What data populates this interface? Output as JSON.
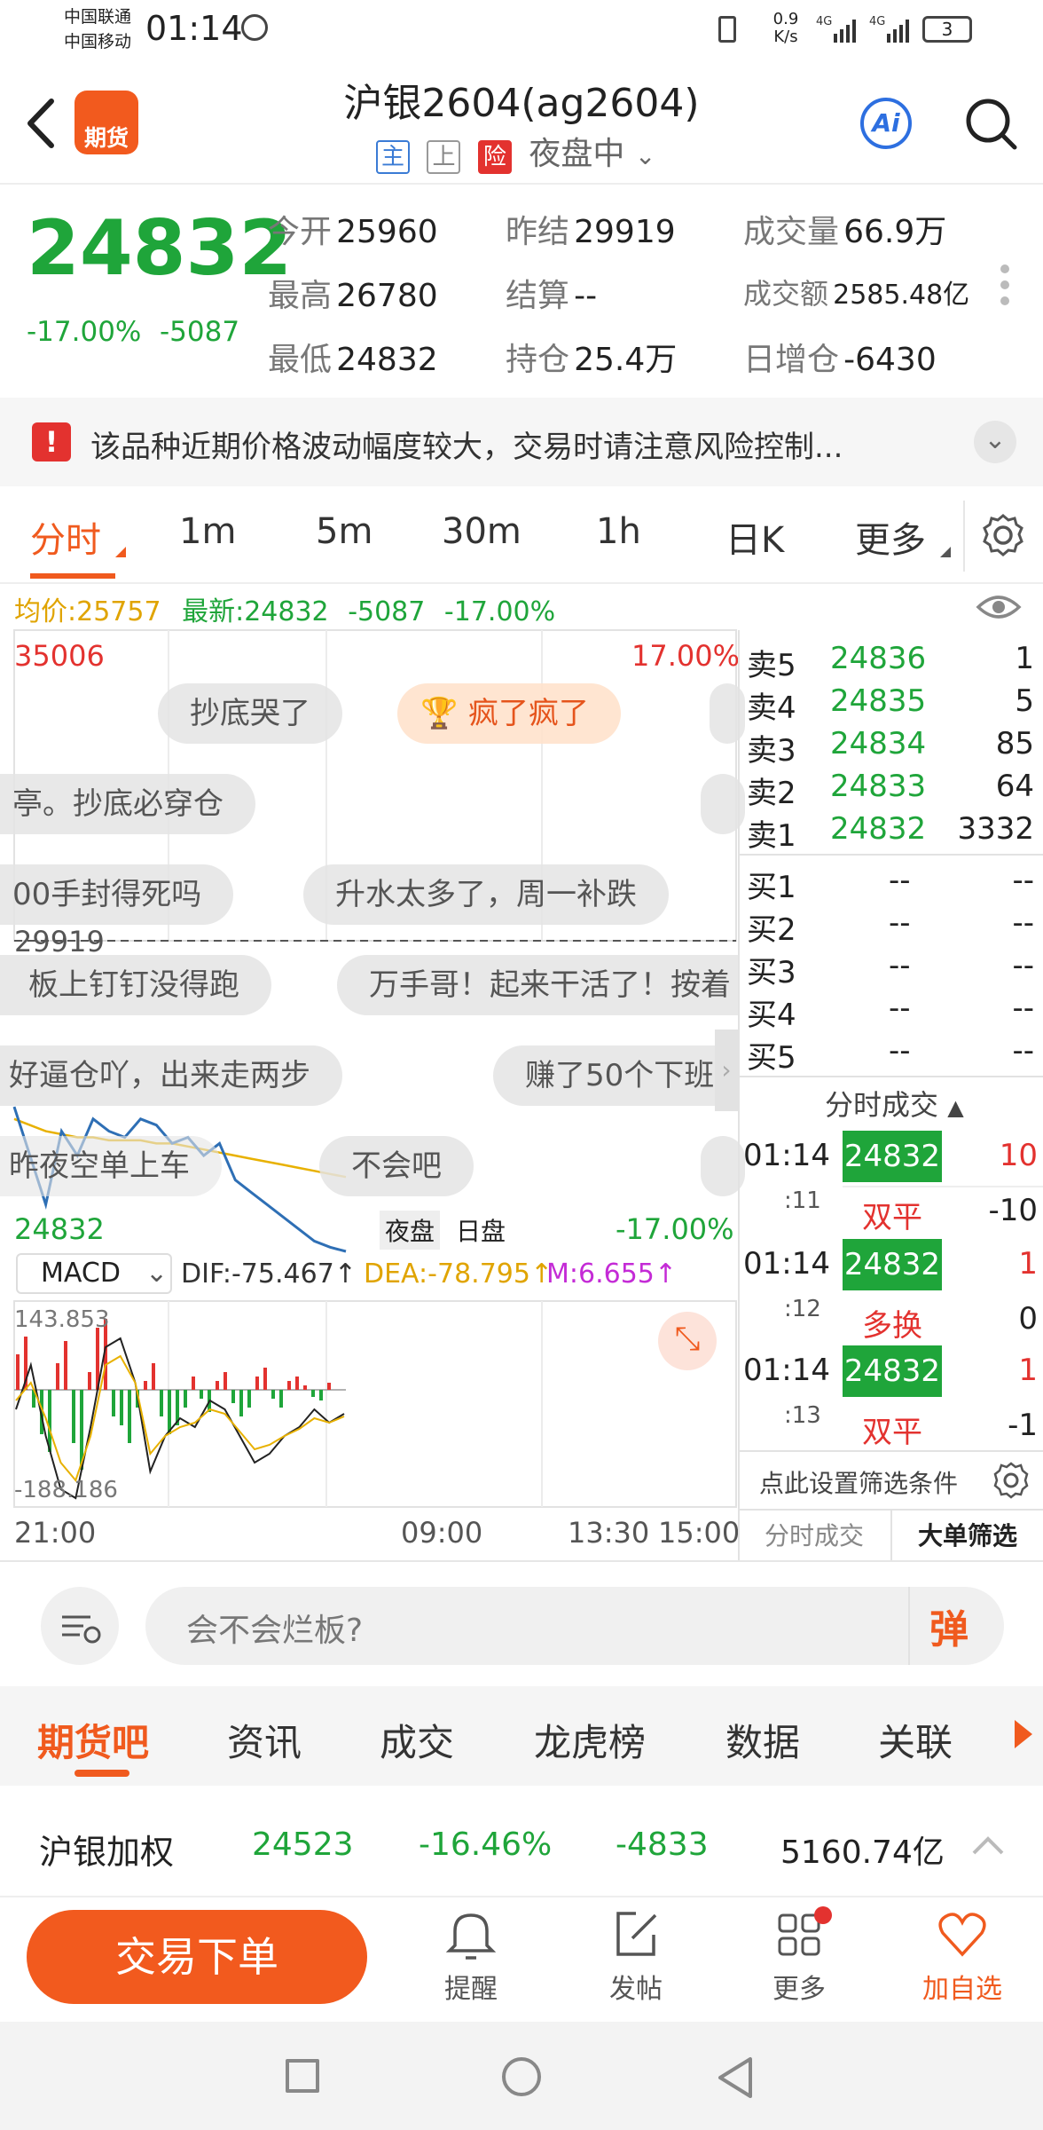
{
  "status_bar": {
    "carrier1": "中国联通",
    "carrier2": "中国移动",
    "time": "01:14",
    "speed_value": "0.9",
    "speed_unit": "K/s",
    "battery": "3"
  },
  "header": {
    "logo_text": "期货",
    "title": "沪银2604(ag2604)",
    "tags": [
      "主",
      "上",
      "险"
    ],
    "session": "夜盘中",
    "ai_label": "Ai"
  },
  "quote": {
    "price": "24832",
    "change_pct": "-17.00%",
    "change": "-5087",
    "fields": [
      {
        "label": "今开",
        "value": "25960",
        "color": "green"
      },
      {
        "label": "昨结",
        "value": "29919",
        "color": "black"
      },
      {
        "label": "成交量",
        "value": "66.9万",
        "color": "black"
      },
      {
        "label": "最高",
        "value": "26780",
        "color": "green"
      },
      {
        "label": "结算",
        "value": "--",
        "color": "black"
      },
      {
        "label": "成交额",
        "value": "2585.48亿",
        "color": "black"
      },
      {
        "label": "最低",
        "value": "24832",
        "color": "green"
      },
      {
        "label": "持仓",
        "value": "25.4万",
        "color": "black"
      },
      {
        "label": "日增仓",
        "value": "-6430",
        "color": "green"
      }
    ]
  },
  "banner": {
    "text": "该品种近期价格波动幅度较大，交易时请注意风险控制..."
  },
  "tabs": [
    "分时",
    "1m",
    "5m",
    "30m",
    "1h",
    "日K",
    "更多"
  ],
  "chart_info": {
    "avg_label": "均价:25757",
    "latest_label": "最新:24832",
    "change": "-5087",
    "change_pct": "-17.00%",
    "top_price": "35006",
    "top_pct": "17.00%",
    "prev_close": "29919",
    "bottom_price": "24832",
    "bottom_pct": "-17.00%",
    "session_night": "夜盘",
    "session_day": "日盘",
    "macd_label": "MACD",
    "dif": "DIF:-75.467↑",
    "dea": "DEA:-78.795↑",
    "m": "M:6.655↑",
    "macd_top": "143.853",
    "macd_bottom": "-188.186",
    "x_ticks": [
      "21:00",
      "09:00",
      "13:30",
      "15:00"
    ]
  },
  "chart_data": {
    "type": "line",
    "x_range": [
      "21:00",
      "15:00"
    ],
    "ylim": [
      24832,
      35006
    ],
    "reference": 29919,
    "series": [
      {
        "name": "最新",
        "values": [
          27200,
          26400,
          25600,
          26800,
          26400,
          27000,
          26800,
          26700,
          27000,
          26900,
          26600,
          26700,
          26400,
          26600,
          26000,
          25800,
          25600,
          25400,
          25200,
          25000,
          24900,
          24832
        ]
      },
      {
        "name": "均价",
        "values": [
          27000,
          26900,
          26800,
          26750,
          26700,
          26700,
          26650,
          26650,
          26650,
          26600,
          26600,
          26550,
          26500,
          26450,
          26400,
          26350,
          26300,
          26250,
          26200,
          26150,
          26100,
          26050
        ]
      }
    ]
  },
  "danmu": [
    "抄底哭了",
    "疯了疯了",
    "亭。抄底必穿仓",
    "00手封得死吗",
    "升水太多了，周一补跌",
    "板上钉钉没得跑",
    "万手哥！起来干活了！按着",
    "好逼仓吖，出来走两步",
    "赚了50个下班",
    "昨夜空单上车",
    "不会吧"
  ],
  "orderbook": {
    "asks": [
      {
        "label": "卖5",
        "price": "24836",
        "vol": "1"
      },
      {
        "label": "卖4",
        "price": "24835",
        "vol": "5"
      },
      {
        "label": "卖3",
        "price": "24834",
        "vol": "85"
      },
      {
        "label": "卖2",
        "price": "24833",
        "vol": "64"
      },
      {
        "label": "卖1",
        "price": "24832",
        "vol": "3332"
      }
    ],
    "bids": [
      {
        "label": "买1",
        "price": "--",
        "vol": "--"
      },
      {
        "label": "买2",
        "price": "--",
        "vol": "--"
      },
      {
        "label": "买3",
        "price": "--",
        "vol": "--"
      },
      {
        "label": "买4",
        "price": "--",
        "vol": "--"
      },
      {
        "label": "买5",
        "price": "--",
        "vol": "--"
      }
    ],
    "trades_title": "分时成交",
    "trades": [
      {
        "time": "01:14",
        "sec": ":11",
        "price": "24832",
        "vol": "10",
        "type": "双平",
        "delta": "-10"
      },
      {
        "time": "01:14",
        "sec": ":12",
        "price": "24832",
        "vol": "1",
        "type": "多换",
        "delta": "0"
      },
      {
        "time": "01:14",
        "sec": ":13",
        "price": "24832",
        "vol": "1",
        "type": "双平",
        "delta": "-1"
      }
    ],
    "filter_label": "点此设置筛选条件",
    "tab_trades": "分时成交",
    "tab_big": "大单筛选"
  },
  "comment": {
    "placeholder": "会不会烂板?",
    "danmu_btn": "弹"
  },
  "subtabs": [
    "期货吧",
    "资讯",
    "成交",
    "龙虎榜",
    "数据",
    "关联"
  ],
  "index_row": {
    "name": "沪银加权",
    "price": "24523",
    "pct": "-16.46%",
    "change": "-4833",
    "amount": "5160.74亿"
  },
  "bottom_bar": {
    "trade_btn": "交易下单",
    "items": [
      "提醒",
      "发帖",
      "更多",
      "加自选"
    ]
  }
}
